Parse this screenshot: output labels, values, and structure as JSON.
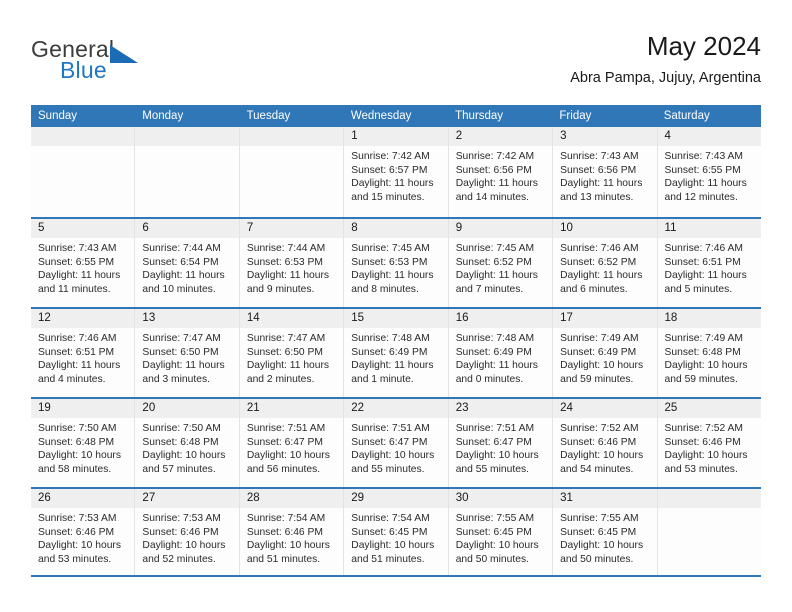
{
  "brand": {
    "name_part1": "General",
    "name_part2": "Blue",
    "logo_icon": "triangle-logo-icon",
    "accent_color": "#1b6cb5"
  },
  "header": {
    "title": "May 2024",
    "subtitle": "Abra Pampa, Jujuy, Argentina"
  },
  "calendar": {
    "header_bg": "#3077b8",
    "daynum_bg": "#efefef",
    "weekdays": [
      "Sunday",
      "Monday",
      "Tuesday",
      "Wednesday",
      "Thursday",
      "Friday",
      "Saturday"
    ],
    "weeks": [
      [
        {
          "day": "",
          "sunrise": "",
          "sunset": "",
          "daylight": "",
          "daylight2": ""
        },
        {
          "day": "",
          "sunrise": "",
          "sunset": "",
          "daylight": "",
          "daylight2": ""
        },
        {
          "day": "",
          "sunrise": "",
          "sunset": "",
          "daylight": "",
          "daylight2": ""
        },
        {
          "day": "1",
          "sunrise": "Sunrise: 7:42 AM",
          "sunset": "Sunset: 6:57 PM",
          "daylight": "Daylight: 11 hours",
          "daylight2": "and 15 minutes."
        },
        {
          "day": "2",
          "sunrise": "Sunrise: 7:42 AM",
          "sunset": "Sunset: 6:56 PM",
          "daylight": "Daylight: 11 hours",
          "daylight2": "and 14 minutes."
        },
        {
          "day": "3",
          "sunrise": "Sunrise: 7:43 AM",
          "sunset": "Sunset: 6:56 PM",
          "daylight": "Daylight: 11 hours",
          "daylight2": "and 13 minutes."
        },
        {
          "day": "4",
          "sunrise": "Sunrise: 7:43 AM",
          "sunset": "Sunset: 6:55 PM",
          "daylight": "Daylight: 11 hours",
          "daylight2": "and 12 minutes."
        }
      ],
      [
        {
          "day": "5",
          "sunrise": "Sunrise: 7:43 AM",
          "sunset": "Sunset: 6:55 PM",
          "daylight": "Daylight: 11 hours",
          "daylight2": "and 11 minutes."
        },
        {
          "day": "6",
          "sunrise": "Sunrise: 7:44 AM",
          "sunset": "Sunset: 6:54 PM",
          "daylight": "Daylight: 11 hours",
          "daylight2": "and 10 minutes."
        },
        {
          "day": "7",
          "sunrise": "Sunrise: 7:44 AM",
          "sunset": "Sunset: 6:53 PM",
          "daylight": "Daylight: 11 hours",
          "daylight2": "and 9 minutes."
        },
        {
          "day": "8",
          "sunrise": "Sunrise: 7:45 AM",
          "sunset": "Sunset: 6:53 PM",
          "daylight": "Daylight: 11 hours",
          "daylight2": "and 8 minutes."
        },
        {
          "day": "9",
          "sunrise": "Sunrise: 7:45 AM",
          "sunset": "Sunset: 6:52 PM",
          "daylight": "Daylight: 11 hours",
          "daylight2": "and 7 minutes."
        },
        {
          "day": "10",
          "sunrise": "Sunrise: 7:46 AM",
          "sunset": "Sunset: 6:52 PM",
          "daylight": "Daylight: 11 hours",
          "daylight2": "and 6 minutes."
        },
        {
          "day": "11",
          "sunrise": "Sunrise: 7:46 AM",
          "sunset": "Sunset: 6:51 PM",
          "daylight": "Daylight: 11 hours",
          "daylight2": "and 5 minutes."
        }
      ],
      [
        {
          "day": "12",
          "sunrise": "Sunrise: 7:46 AM",
          "sunset": "Sunset: 6:51 PM",
          "daylight": "Daylight: 11 hours",
          "daylight2": "and 4 minutes."
        },
        {
          "day": "13",
          "sunrise": "Sunrise: 7:47 AM",
          "sunset": "Sunset: 6:50 PM",
          "daylight": "Daylight: 11 hours",
          "daylight2": "and 3 minutes."
        },
        {
          "day": "14",
          "sunrise": "Sunrise: 7:47 AM",
          "sunset": "Sunset: 6:50 PM",
          "daylight": "Daylight: 11 hours",
          "daylight2": "and 2 minutes."
        },
        {
          "day": "15",
          "sunrise": "Sunrise: 7:48 AM",
          "sunset": "Sunset: 6:49 PM",
          "daylight": "Daylight: 11 hours",
          "daylight2": "and 1 minute."
        },
        {
          "day": "16",
          "sunrise": "Sunrise: 7:48 AM",
          "sunset": "Sunset: 6:49 PM",
          "daylight": "Daylight: 11 hours",
          "daylight2": "and 0 minutes."
        },
        {
          "day": "17",
          "sunrise": "Sunrise: 7:49 AM",
          "sunset": "Sunset: 6:49 PM",
          "daylight": "Daylight: 10 hours",
          "daylight2": "and 59 minutes."
        },
        {
          "day": "18",
          "sunrise": "Sunrise: 7:49 AM",
          "sunset": "Sunset: 6:48 PM",
          "daylight": "Daylight: 10 hours",
          "daylight2": "and 59 minutes."
        }
      ],
      [
        {
          "day": "19",
          "sunrise": "Sunrise: 7:50 AM",
          "sunset": "Sunset: 6:48 PM",
          "daylight": "Daylight: 10 hours",
          "daylight2": "and 58 minutes."
        },
        {
          "day": "20",
          "sunrise": "Sunrise: 7:50 AM",
          "sunset": "Sunset: 6:48 PM",
          "daylight": "Daylight: 10 hours",
          "daylight2": "and 57 minutes."
        },
        {
          "day": "21",
          "sunrise": "Sunrise: 7:51 AM",
          "sunset": "Sunset: 6:47 PM",
          "daylight": "Daylight: 10 hours",
          "daylight2": "and 56 minutes."
        },
        {
          "day": "22",
          "sunrise": "Sunrise: 7:51 AM",
          "sunset": "Sunset: 6:47 PM",
          "daylight": "Daylight: 10 hours",
          "daylight2": "and 55 minutes."
        },
        {
          "day": "23",
          "sunrise": "Sunrise: 7:51 AM",
          "sunset": "Sunset: 6:47 PM",
          "daylight": "Daylight: 10 hours",
          "daylight2": "and 55 minutes."
        },
        {
          "day": "24",
          "sunrise": "Sunrise: 7:52 AM",
          "sunset": "Sunset: 6:46 PM",
          "daylight": "Daylight: 10 hours",
          "daylight2": "and 54 minutes."
        },
        {
          "day": "25",
          "sunrise": "Sunrise: 7:52 AM",
          "sunset": "Sunset: 6:46 PM",
          "daylight": "Daylight: 10 hours",
          "daylight2": "and 53 minutes."
        }
      ],
      [
        {
          "day": "26",
          "sunrise": "Sunrise: 7:53 AM",
          "sunset": "Sunset: 6:46 PM",
          "daylight": "Daylight: 10 hours",
          "daylight2": "and 53 minutes."
        },
        {
          "day": "27",
          "sunrise": "Sunrise: 7:53 AM",
          "sunset": "Sunset: 6:46 PM",
          "daylight": "Daylight: 10 hours",
          "daylight2": "and 52 minutes."
        },
        {
          "day": "28",
          "sunrise": "Sunrise: 7:54 AM",
          "sunset": "Sunset: 6:46 PM",
          "daylight": "Daylight: 10 hours",
          "daylight2": "and 51 minutes."
        },
        {
          "day": "29",
          "sunrise": "Sunrise: 7:54 AM",
          "sunset": "Sunset: 6:45 PM",
          "daylight": "Daylight: 10 hours",
          "daylight2": "and 51 minutes."
        },
        {
          "day": "30",
          "sunrise": "Sunrise: 7:55 AM",
          "sunset": "Sunset: 6:45 PM",
          "daylight": "Daylight: 10 hours",
          "daylight2": "and 50 minutes."
        },
        {
          "day": "31",
          "sunrise": "Sunrise: 7:55 AM",
          "sunset": "Sunset: 6:45 PM",
          "daylight": "Daylight: 10 hours",
          "daylight2": "and 50 minutes."
        },
        {
          "day": "",
          "sunrise": "",
          "sunset": "",
          "daylight": "",
          "daylight2": ""
        }
      ]
    ]
  }
}
